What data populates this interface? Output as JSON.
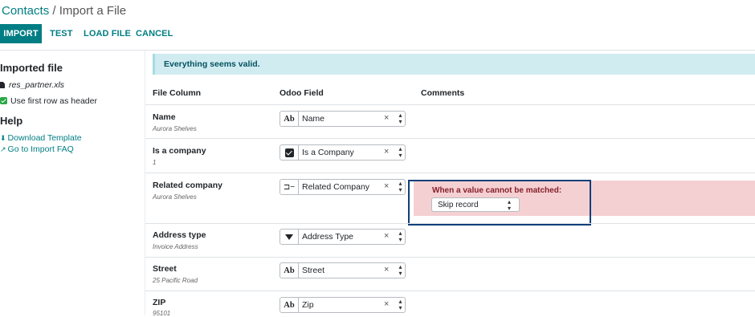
{
  "breadcrumb": {
    "root": "Contacts",
    "separator": "/",
    "current": "Import a File"
  },
  "toolbar": {
    "import": "IMPORT",
    "test": "TEST",
    "load_file": "LOAD FILE",
    "cancel": "CANCEL"
  },
  "sidebar": {
    "imported_file_heading": "Imported file",
    "file_name": "res_partner.xls",
    "use_first_row": "Use first row as header",
    "help_heading": "Help",
    "download_template": "Download Template",
    "import_faq": "Go to Import FAQ"
  },
  "alert": {
    "message": "Everything seems valid."
  },
  "columns": {
    "file_column": "File Column",
    "odoo_field": "Odoo Field",
    "comments": "Comments"
  },
  "rows": [
    {
      "name": "Name",
      "sample": "Aurora Shelves",
      "field": "Name",
      "icon": "text-type-icon"
    },
    {
      "name": "Is a company",
      "sample": "1",
      "field": "Is a Company",
      "icon": "checkbox-type-icon"
    },
    {
      "name": "Related company",
      "sample": "Aurora Shelves",
      "field": "Related Company",
      "icon": "relation-type-icon"
    },
    {
      "name": "Address type",
      "sample": "Invoice Address",
      "field": "Address Type",
      "icon": "selection-type-icon"
    },
    {
      "name": "Street",
      "sample": "25 Pacific Road",
      "field": "Street",
      "icon": "text-type-icon"
    },
    {
      "name": "ZIP",
      "sample": "95101",
      "field": "Zip",
      "icon": "text-type-icon"
    }
  ],
  "field_type_labels": {
    "text": "Ab"
  },
  "glyphs": {
    "clear": "×",
    "sort_arrows": "⌃⌄",
    "relation": "⊐−",
    "download": "⬇",
    "external": "↗"
  },
  "comment": {
    "label": "When a value cannot be matched:",
    "selected_option": "Skip record"
  },
  "colors": {
    "accent": "#017e84",
    "alert_bg": "#d0ecf1",
    "error_bg": "#f5d0d3",
    "highlight_border": "#0f3f7a"
  }
}
